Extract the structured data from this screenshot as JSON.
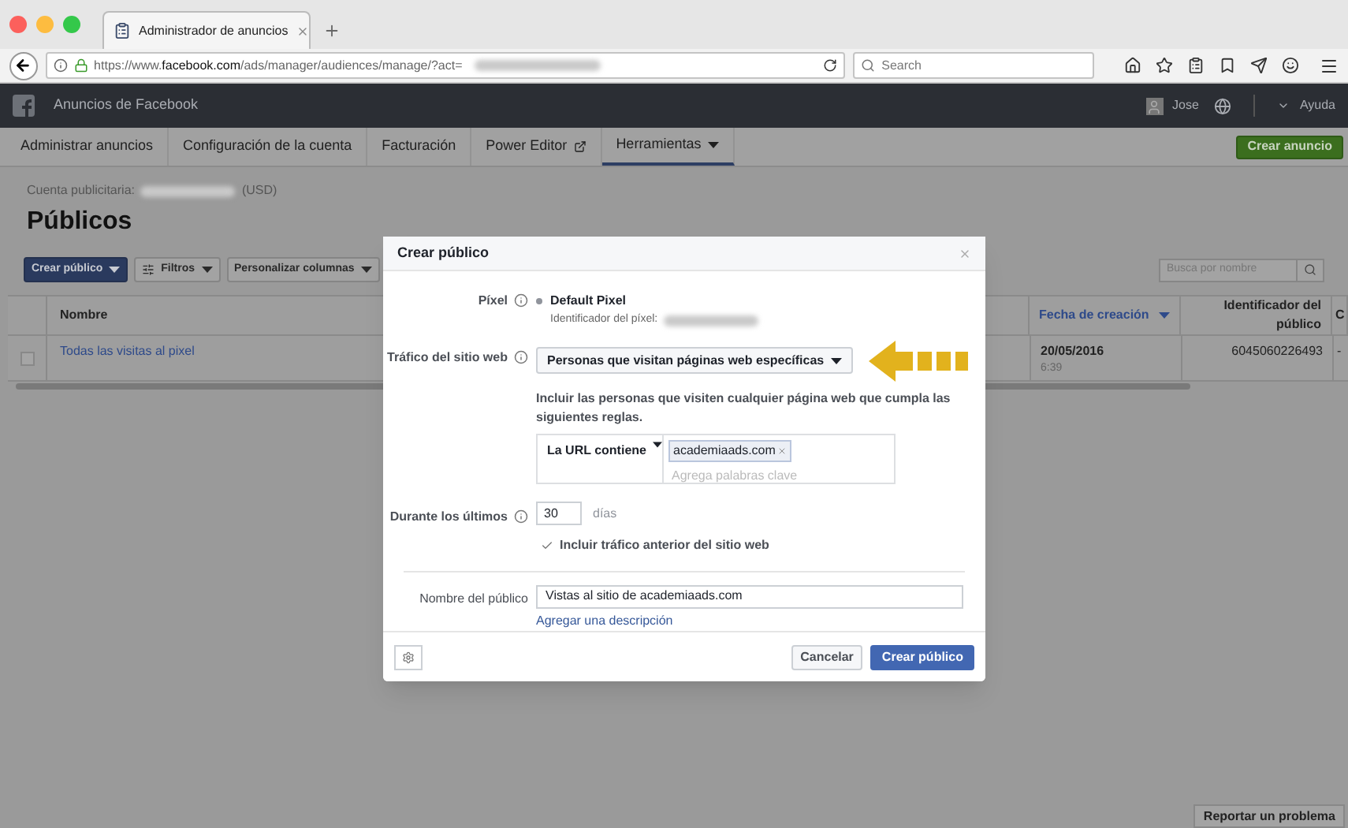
{
  "browser": {
    "tab_title": "Administrador de anuncios",
    "url_prefix": "https://www.",
    "url_domain": "facebook.com",
    "url_path": "/ads/manager/audiences/manage/?act=",
    "search_placeholder": "Search"
  },
  "fb_header": {
    "title": "Anuncios de Facebook",
    "user": "Jose",
    "help": "Ayuda"
  },
  "nav": {
    "items": [
      {
        "label": "Administrar anuncios",
        "selected": false,
        "kind": "plain"
      },
      {
        "label": "Configuración de la cuenta",
        "selected": false,
        "kind": "plain"
      },
      {
        "label": "Facturación",
        "selected": false,
        "kind": "plain"
      },
      {
        "label": "Power Editor",
        "selected": false,
        "kind": "external"
      },
      {
        "label": "Herramientas",
        "selected": true,
        "kind": "dropdown"
      }
    ],
    "create_button": "Crear anuncio"
  },
  "account": {
    "label": "Cuenta publicitaria:",
    "currency": "(USD)"
  },
  "page_title": "Públicos",
  "toolbar": {
    "buttons": [
      {
        "label": "Crear público",
        "kind": "primary"
      },
      {
        "label": "Filtros",
        "kind": "filter"
      },
      {
        "label": "Personalizar columnas",
        "kind": "default"
      }
    ],
    "search_placeholder": "Busca por nombre"
  },
  "table": {
    "columns": [
      {
        "label": "Nombre",
        "sorted": false
      },
      {
        "label": "Fecha de creación",
        "sorted": true
      },
      {
        "label": "Identificador del público",
        "sorted": false
      },
      {
        "label": "C",
        "sorted": false
      }
    ],
    "rows": [
      {
        "name": "Todas las visitas al pixel",
        "date": "20/05/2016",
        "time": "6:39",
        "id": "6045060226493",
        "column_4": "-",
        "checked": false
      }
    ]
  },
  "modal": {
    "title": "Crear público",
    "pixel_label": "Píxel",
    "pixel_name": "Default Pixel",
    "pixel_id_label": "Identificador del píxel:",
    "traffic_label": "Tráfico del sitio web",
    "traffic_value": "Personas que visitan páginas web específicas",
    "rule_text": "Incluir las personas que visiten cualquier página web que cumpla las siguientes reglas.",
    "rule_condition": "La URL contiene",
    "tags": [
      "academiaads.com"
    ],
    "keyword_placeholder": "Agrega palabras clave",
    "days_label": "Durante los últimos",
    "days_value": "30",
    "days_unit": "días",
    "include_past": {
      "label": "Incluir tráfico anterior del sitio web",
      "checked": true
    },
    "name_label": "Nombre del público",
    "name_value": "Vistas al sitio de academiaads.com",
    "add_description": "Agregar una descripción",
    "cancel": "Cancelar",
    "create": "Crear público"
  },
  "footer": {
    "report": "Reportar un problema"
  }
}
